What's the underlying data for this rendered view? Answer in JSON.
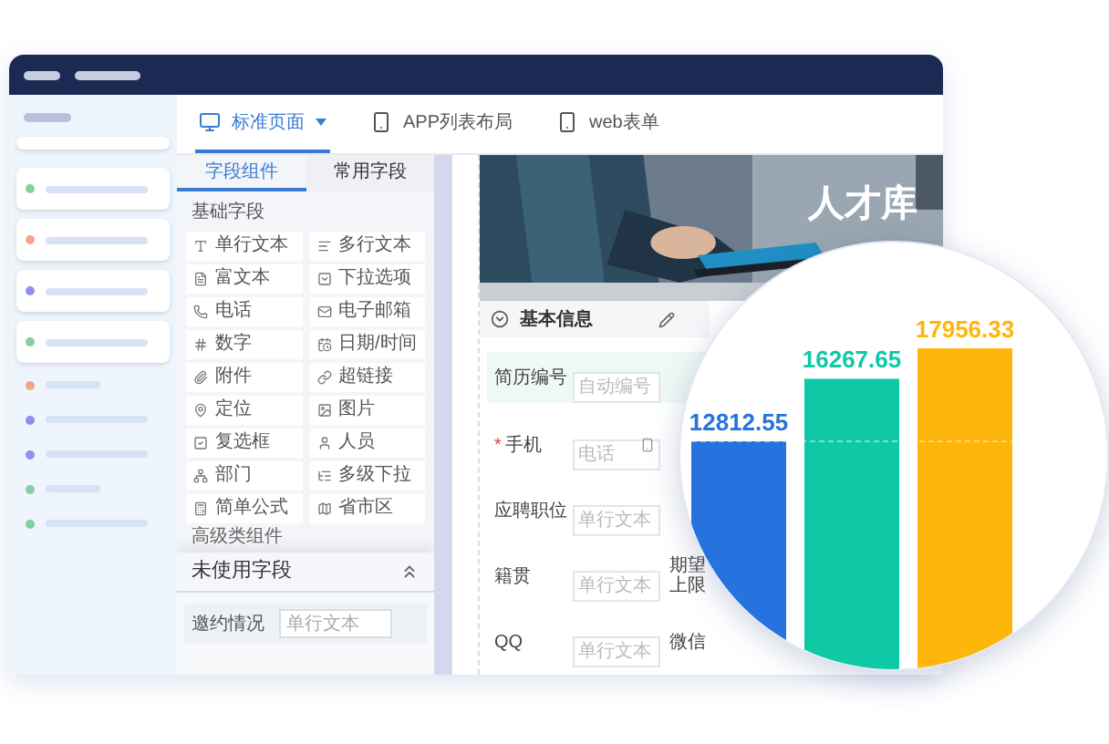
{
  "tabs": [
    {
      "label": "标准页面",
      "selected": true,
      "dropdown": true
    },
    {
      "label": "APP列表布局",
      "selected": false
    },
    {
      "label": "web表单",
      "selected": false
    }
  ],
  "sidebar": {
    "items": [
      {
        "kind": "card",
        "color": "#86cfa0"
      },
      {
        "kind": "card",
        "color": "#f4a48e"
      },
      {
        "kind": "card",
        "color": "#8f8ff0"
      },
      {
        "kind": "card",
        "color": "#86cfa0"
      },
      {
        "kind": "row",
        "color": "#f4a48e"
      },
      {
        "kind": "row",
        "color": "#8f8ff0"
      },
      {
        "kind": "row",
        "color": "#8f8ff0"
      },
      {
        "kind": "row",
        "color": "#86cfa0"
      },
      {
        "kind": "row",
        "color": "#86cfa0"
      }
    ]
  },
  "panel": {
    "tabs": [
      {
        "label": "字段组件",
        "selected": true
      },
      {
        "label": "常用字段",
        "selected": false
      }
    ],
    "section_title": "基础字段",
    "fields": [
      "单行文本",
      "多行文本",
      "富文本",
      "下拉选项",
      "电话",
      "电子邮箱",
      "数字",
      "日期/时间",
      "附件",
      "超链接",
      "定位",
      "图片",
      "复选框",
      "人员",
      "部门",
      "多级下拉",
      "简单公式",
      "省市区"
    ],
    "advanced_title": "高级类组件",
    "unused": {
      "title": "未使用字段",
      "expanded": true,
      "rows": [
        {
          "label": "邀约情况",
          "placeholder": "单行文本"
        }
      ]
    }
  },
  "form": {
    "banner_title": "人才库",
    "section": {
      "title": "基本信息",
      "expanded": true
    },
    "rows": [
      {
        "highlighted": true,
        "cells": [
          {
            "label": "简历编号",
            "placeholder": "自动编号"
          }
        ]
      },
      {
        "highlighted": false,
        "cells": [
          {
            "label": "手机",
            "required_mark": "*",
            "placeholder": "电话",
            "kind": "phone"
          }
        ]
      },
      {
        "highlighted": false,
        "cells": [
          {
            "label": "应聘职位",
            "placeholder": "单行文本"
          }
        ]
      },
      {
        "highlighted": false,
        "cells": [
          {
            "label": "籍贯",
            "placeholder": "单行文本"
          },
          {
            "label": "期望上限"
          }
        ]
      },
      {
        "highlighted": false,
        "cells": [
          {
            "label": "QQ",
            "placeholder": "单行文本"
          },
          {
            "label": "微信"
          }
        ]
      }
    ]
  },
  "magnifier": {
    "bars": [
      {
        "label": "12812.55"
      },
      {
        "label": "16267.65"
      },
      {
        "label": "17956.33"
      }
    ]
  }
}
